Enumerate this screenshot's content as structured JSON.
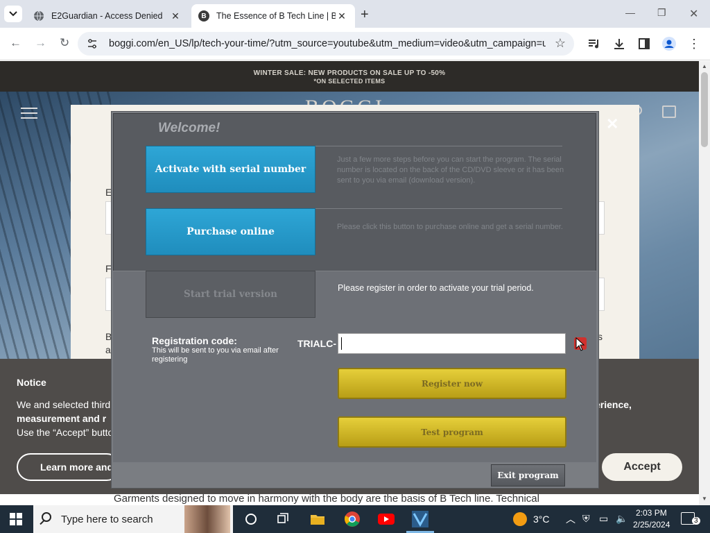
{
  "browser": {
    "tabs": [
      {
        "title": "E2Guardian - Access Denied",
        "active": false
      },
      {
        "title": "The Essence of B Tech Line | Bo",
        "active": true
      }
    ],
    "url": "boggi.com/en_US/lp/tech-your-time/?utm_source=youtube&utm_medium=video&utm_campaign=u..."
  },
  "page": {
    "sale_line1": "WINTER SALE: NEW PRODUCTS ON SALE UP TO -50%",
    "sale_line2": "*ON SELECTED ITEMS",
    "brand": "BOGGI",
    "form_label_1": "E",
    "form_label_2": "F",
    "form_label_3": "B",
    "form_label_4": "a",
    "form_label_right": "s",
    "bottom_text": "Garments designed to move in harmony with the body are the basis of B Tech line. Technical"
  },
  "cookie": {
    "title": "Notice",
    "line1": "We and selected third",
    "line2": "measurement and r",
    "line3": "Use the “Accept” butto",
    "line_right": "erience,",
    "learn_more": "Learn more and",
    "accept": "Accept"
  },
  "dialog": {
    "welcome": "Welcome!",
    "activate_label": "Activate with serial number",
    "activate_desc": "Just a few more steps before you can start the program. The serial number is located on the back of the CD/DVD sleeve or it has been sent to you via email (download version).",
    "purchase_label": "Purchase online",
    "purchase_desc": "Please click this button to purchase online and get a serial number.",
    "trial_label": "Start trial version",
    "trial_desc": "Please register in order to activate your trial period.",
    "reg_code_label": "Registration code:",
    "reg_code_sub": "This will be sent to you via email after registering",
    "reg_prefix": "TRIALC-",
    "reg_value": "",
    "register_btn": "Register now",
    "test_btn": "Test program",
    "exit_btn": "Exit program"
  },
  "taskbar": {
    "search_placeholder": "Type here to search",
    "weather": "3°C",
    "time": "2:03 PM",
    "date": "2/25/2024",
    "notification_count": "3"
  },
  "colors": {
    "blue_button": "#2ea6d6",
    "gold_button": "#d9c02c",
    "dialog_bg": "#585b60"
  }
}
